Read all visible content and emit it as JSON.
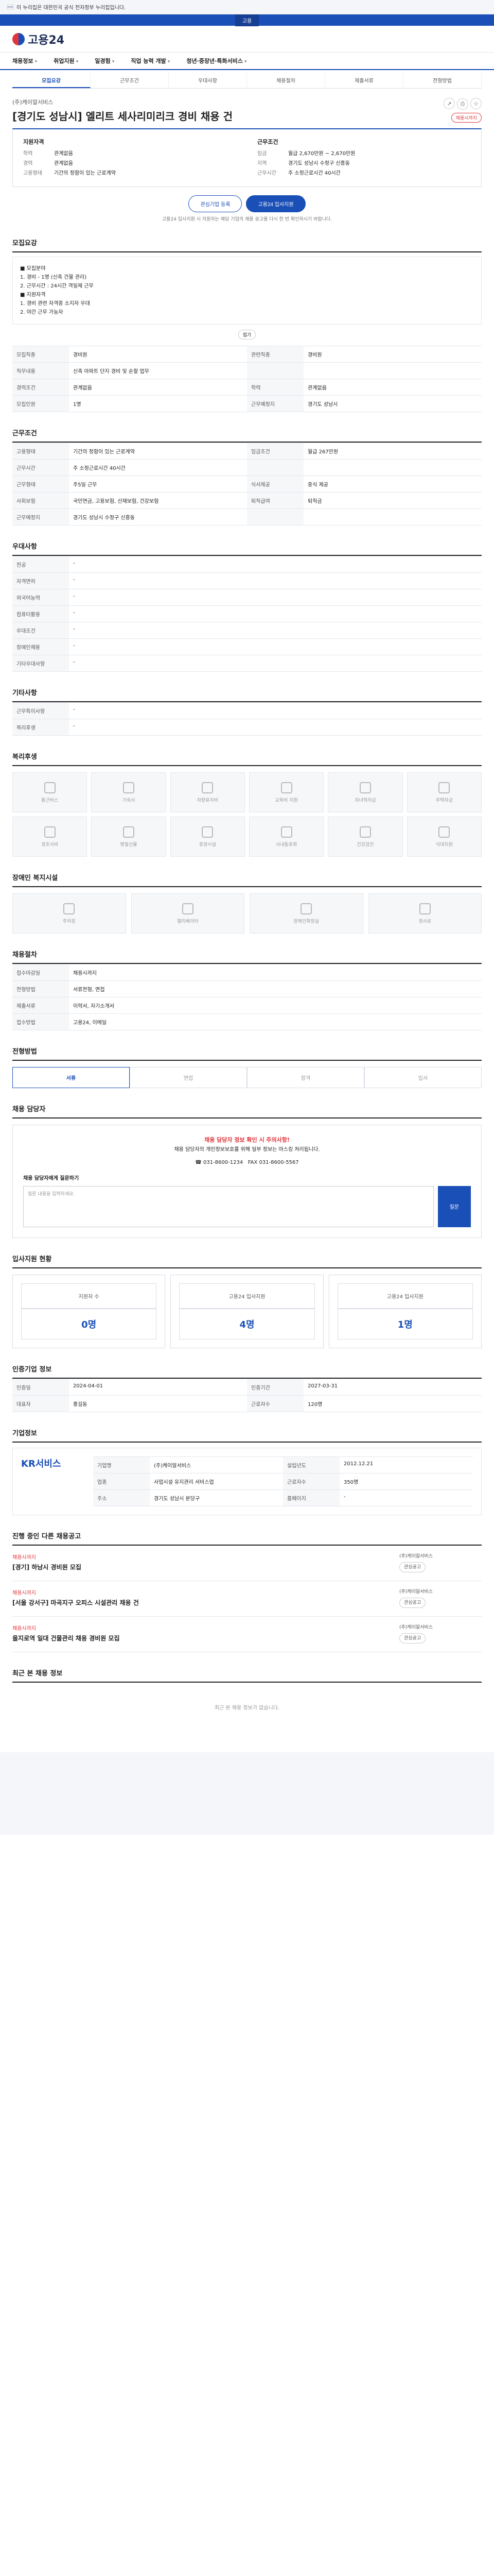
{
  "gov": {
    "text": "이 누리집은 대한민국 공식 전자정부 누리집입니다."
  },
  "gnav": {
    "items": [
      "",
      "고용",
      ""
    ]
  },
  "site": {
    "name": "고용24"
  },
  "nav": {
    "items": [
      "채용정보",
      "취업지원",
      "일경험",
      "직업 능력 개발",
      "청년·중장년·특화서비스"
    ]
  },
  "tabs": [
    "모집요강",
    "근무조건",
    "우대사항",
    "채용절차",
    "제출서류",
    "전형방법"
  ],
  "job": {
    "company": "(주)케이알서비스",
    "title": "[경기도 성남시] 엘리트 세사리미리크 경비 채용 건",
    "badge": "채용시까지"
  },
  "summary": {
    "left_head": "지원자격",
    "right_head": "근무조건",
    "edu_k": "학력",
    "edu_v": "관계없음",
    "career_k": "경력",
    "career_v": "관계없음",
    "pay_k": "임금",
    "pay_v": "월급 2,670만원 ~ 2,670만원",
    "loc_k": "지역",
    "loc_v": "경기도 성남시 수정구 신흥동",
    "type_k": "고용형태",
    "type_v": "기간의 정함이 있는 근로계약",
    "hours_k": "근무시간",
    "hours_v": "주 소정근로시간 40시간"
  },
  "buttons": {
    "interest": "관심기업 등록",
    "apply": "고용24 입사지원"
  },
  "notice": "고용24 입사지원 시 지원자는 해당 기업의 채용 공고를 다시 한 번 확인하시기 바랍니다.",
  "recruit": {
    "h": "모집요강",
    "body": "■ 모집분야\n1. 경비 - 1명 (신축 건물 관리)\n2. 근무시간 : 24시간 격일제 근무\n■ 지원자격\n1. 경비 관련 자격증 소지자 우대\n2. 야간 근무 가능자",
    "more": "접기"
  },
  "req": {
    "rows": [
      [
        "모집직종",
        "경비원",
        "관련직종",
        "경비원"
      ],
      [
        "직무내용",
        "신축 아파트 단지 경비 및 순찰 업무",
        "",
        ""
      ],
      [
        "경력조건",
        "관계없음",
        "학력",
        "관계없음"
      ],
      [
        "모집인원",
        "1명",
        "근무예정지",
        "경기도 성남시"
      ]
    ]
  },
  "cond": {
    "h": "근무조건",
    "rows": [
      [
        "고용형태",
        "기간의 정함이 있는 근로계약",
        "임금조건",
        "월급 267만원"
      ],
      [
        "근무시간",
        "주 소정근로시간 40시간",
        "",
        ""
      ],
      [
        "근무형태",
        "주5일 근무",
        "식사제공",
        "중식 제공"
      ],
      [
        "사회보험",
        "국민연금, 고용보험, 산재보험, 건강보험",
        "퇴직급여",
        "퇴직금"
      ],
      [
        "근무예정지",
        "경기도 성남시 수정구 신흥동",
        "",
        ""
      ]
    ]
  },
  "pref": {
    "h": "우대사항",
    "rows": [
      [
        "전공",
        "-"
      ],
      [
        "자격면허",
        "-"
      ],
      [
        "외국어능력",
        "-"
      ],
      [
        "컴퓨터활용",
        "-"
      ],
      [
        "우대조건",
        "-"
      ],
      [
        "장애인채용",
        "-"
      ],
      [
        "기타우대사항",
        "-"
      ]
    ]
  },
  "etc": {
    "h": "기타사항",
    "rows": [
      [
        "근무특이사항",
        "-"
      ],
      [
        "복리후생",
        "-"
      ]
    ]
  },
  "welfare": {
    "h": "복리후생",
    "items": [
      "통근버스",
      "기숙사",
      "차량유지비",
      "교육비 지원",
      "자녀학자금",
      "주택자금",
      "경조사비",
      "명절선물",
      "휴양시설",
      "사내동호회",
      "건강검진",
      "식대지원"
    ]
  },
  "disab": {
    "h": "장애인 복지시설",
    "items": [
      "주차장",
      "엘리베이터",
      "장애인화장실",
      "경사로"
    ]
  },
  "proc": {
    "h": "채용절차",
    "rows": [
      [
        "접수마감일",
        "채용시까지"
      ],
      [
        "전형방법",
        "서류전형, 면접"
      ],
      [
        "제출서류",
        "이력서, 자기소개서"
      ],
      [
        "접수방법",
        "고용24, 이메일"
      ]
    ]
  },
  "method": {
    "h": "전형방법",
    "steps": [
      "서류",
      "면접",
      "합격",
      "입사"
    ]
  },
  "contact": {
    "h": "채용 담당자",
    "alert": "채용 담당자 정보 확인 시 주의사항!",
    "body": "채용 담당자의 개인정보보호를 위해 일부 정보는 마스킹 처리됩니다.",
    "tel": "031-8600-1234",
    "fax": "031-8600-5567",
    "ask_h": "채용 담당자에게 질문하기",
    "ask_ph": "질문 내용을 입력하세요.",
    "ask_btn": "질문"
  },
  "stat": {
    "h": "입사지원 현황",
    "items": [
      {
        "l": "지원자 수",
        "n": "0명"
      },
      {
        "l": "고용24 입사지원",
        "n": "4명"
      },
      {
        "l": "고용24 입사지원",
        "n": "1명"
      }
    ]
  },
  "info": {
    "h": "인증기업 정보",
    "rows": [
      [
        "인증일",
        "2024-04-01",
        "인증기간",
        "2027-03-31"
      ],
      [
        "대표자",
        "홍길동",
        "근로자수",
        "120명"
      ]
    ]
  },
  "corp": {
    "h": "기업정보",
    "logo": "KR서비스",
    "rows": [
      [
        "기업명",
        "(주)케이알서비스",
        "설립년도",
        "2012.12.21"
      ],
      [
        "업종",
        "사업시설 유지관리 서비스업",
        "근로자수",
        "350명"
      ],
      [
        "주소",
        "경기도 성남시 분당구",
        "홈페이지",
        "-"
      ]
    ]
  },
  "jobs": {
    "h": "진행 중인 다른 채용공고",
    "items": [
      {
        "c": "채용시까지",
        "t": "[경기] 하남시 경비원 모집",
        "m": "(주)케이알서비스"
      },
      {
        "c": "채용시까지",
        "t": "[서울 강서구] 마곡지구 오피스 시설관리 채용 건",
        "m": "(주)케이알서비스"
      },
      {
        "c": "채용시까지",
        "t": "을지로역 일대 건물관리 채용 경비원 모집",
        "m": "(주)케이알서비스"
      }
    ],
    "btn": "관심공고"
  },
  "recent": {
    "h": "최근 본 채용 정보",
    "empty": "최근 본 채용 정보가 없습니다."
  }
}
